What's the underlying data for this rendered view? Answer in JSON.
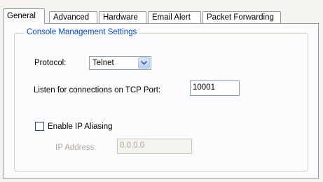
{
  "tabs": [
    {
      "label": "General",
      "active": true
    },
    {
      "label": "Advanced",
      "active": false
    },
    {
      "label": "Hardware",
      "active": false
    },
    {
      "label": "Email Alert",
      "active": false
    },
    {
      "label": "Packet Forwarding",
      "active": false
    }
  ],
  "group": {
    "title": "Console Management Settings"
  },
  "protocol": {
    "label": "Protocol:",
    "value": "Telnet",
    "icon": "chevron-down-icon"
  },
  "listen": {
    "label": "Listen for connections on TCP Port:",
    "value": "10001"
  },
  "aliasing": {
    "label": "Enable IP Aliasing",
    "checked": false
  },
  "ip": {
    "label": "IP Address:",
    "value": "0.0.0.0",
    "enabled": false
  },
  "colors": {
    "accent": "#0046d5",
    "tab_border": "#919b9c",
    "input_border": "#7f9db9"
  }
}
